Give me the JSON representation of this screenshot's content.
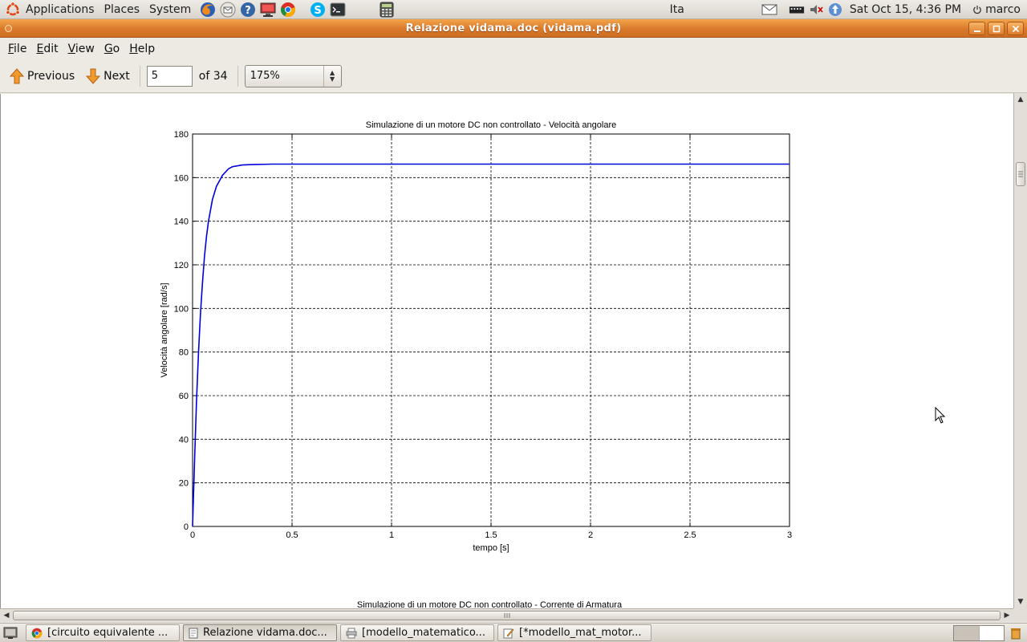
{
  "top_panel": {
    "menus": [
      "Applications",
      "Places",
      "System"
    ],
    "launchers": [
      "firefox-icon",
      "mail-icon",
      "help-icon",
      "remote-desktop-icon",
      "chrome-icon",
      "skype-icon",
      "terminal-icon",
      "calculator-icon"
    ],
    "keyboard_layout": "Ita",
    "datetime": "Sat Oct 15,  4:36 PM",
    "user": "marco"
  },
  "window": {
    "title": "Relazione vidama.doc (vidama.pdf)"
  },
  "menubar": {
    "items": [
      {
        "label": "File",
        "mnemonic": "F",
        "rest": "ile"
      },
      {
        "label": "Edit",
        "mnemonic": "E",
        "rest": "dit"
      },
      {
        "label": "View",
        "mnemonic": "V",
        "rest": "iew"
      },
      {
        "label": "Go",
        "mnemonic": "G",
        "rest": "o"
      },
      {
        "label": "Help",
        "mnemonic": "H",
        "rest": "elp"
      }
    ]
  },
  "toolbar": {
    "previous_label": "Previous",
    "next_label": "Next",
    "page_value": "5",
    "page_of": "of 34",
    "zoom_value": "175%"
  },
  "chart_data": {
    "type": "line",
    "title": "Simulazione di un motore DC non controllato - Velocità angolare",
    "xlabel": "tempo [s]",
    "ylabel": "Velocità angolare [rad/s]",
    "xlim": [
      0,
      3
    ],
    "ylim": [
      0,
      180
    ],
    "xticks": [
      0,
      0.5,
      1,
      1.5,
      2,
      2.5,
      3
    ],
    "xtick_labels": [
      "0",
      "0.5",
      "1",
      "1.5",
      "2",
      "2.5",
      "3"
    ],
    "yticks": [
      0,
      20,
      40,
      60,
      80,
      100,
      120,
      140,
      160,
      180
    ],
    "ytick_labels": [
      "0",
      "20",
      "40",
      "60",
      "80",
      "100",
      "120",
      "140",
      "160",
      "180"
    ],
    "grid": true,
    "line_color": "#0000dd",
    "series": [
      {
        "x": [
          0,
          0.01,
          0.02,
          0.03,
          0.04,
          0.05,
          0.06,
          0.07,
          0.08,
          0.1,
          0.12,
          0.15,
          0.18,
          0.2,
          0.25,
          0.3,
          0.4,
          0.5,
          1,
          1.5,
          2,
          2.5,
          3
        ],
        "y": [
          0,
          30,
          58,
          80,
          98,
          112,
          124,
          133,
          140,
          150,
          156,
          161,
          164,
          165,
          165.8,
          166,
          166.2,
          166.2,
          166.2,
          166.2,
          166.2,
          166.2,
          166.2
        ]
      }
    ],
    "next_figure_title_partial": "Simulazione di un motore DC non controllato - Corrente di Armatura"
  },
  "taskbar": {
    "tasks": [
      {
        "label": "[circuito equivalente ...",
        "icon": "chrome-icon",
        "active": false
      },
      {
        "label": "Relazione vidama.doc...",
        "icon": "document-viewer-icon",
        "active": true
      },
      {
        "label": "[modello_matematico...",
        "icon": "printer-icon",
        "active": false
      },
      {
        "label": "[*modello_mat_motor...",
        "icon": "text-editor-icon",
        "active": false
      }
    ]
  }
}
